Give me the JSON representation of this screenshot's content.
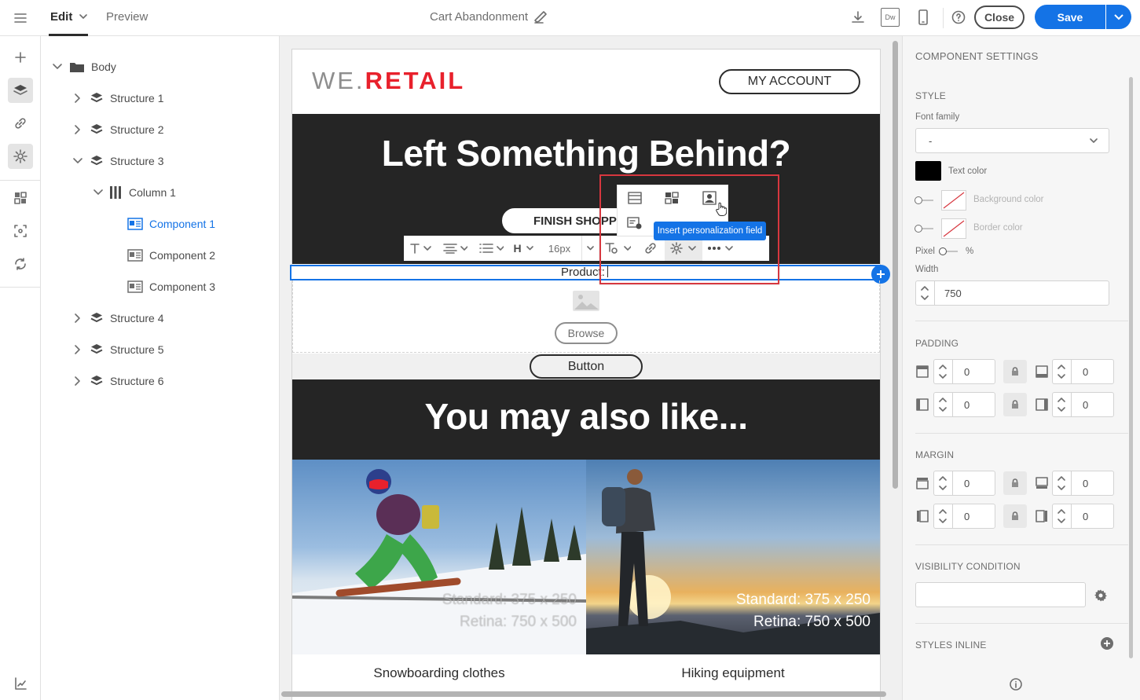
{
  "header": {
    "edit_label": "Edit",
    "preview_label": "Preview",
    "document_title": "Cart Abandonment",
    "close_label": "Close",
    "save_label": "Save",
    "dw_label": "Dw"
  },
  "tree": {
    "body_label": "Body",
    "items": [
      {
        "label": "Structure 1"
      },
      {
        "label": "Structure 2"
      },
      {
        "label": "Structure 3"
      },
      {
        "label": "Column 1"
      },
      {
        "label": "Component 1"
      },
      {
        "label": "Component 2"
      },
      {
        "label": "Component 3"
      },
      {
        "label": "Structure 4"
      },
      {
        "label": "Structure 5"
      },
      {
        "label": "Structure 6"
      }
    ]
  },
  "email": {
    "logo_part1": "WE.",
    "logo_part2": "RETAIL",
    "account_button": "MY ACCOUNT",
    "hero_title": "Left Something Behind?",
    "finish_button": "FINISH SHOPP",
    "product_text": "Product:",
    "browse_button": "Browse",
    "generic_button": "Button",
    "also_like_title": "You may also like...",
    "products": [
      {
        "caption": "Snowboarding clothes",
        "overlay1": "Standard: 375 x 250",
        "overlay2": "Retina: 750 x 500"
      },
      {
        "caption": "Hiking equipment",
        "overlay1": "Standard: 375 x 250",
        "overlay2": "Retina: 750 x 500"
      }
    ]
  },
  "toolbar": {
    "font_size": "16px",
    "heading_label": "H",
    "tooltip": "Insert personalization field"
  },
  "settings": {
    "title": "COMPONENT SETTINGS",
    "style_label": "STYLE",
    "font_family_label": "Font family",
    "font_family_value": "-",
    "text_color_label": "Text color",
    "text_color": "#000000",
    "background_color_label": "Background color",
    "border_color_label": "Border color",
    "pixel_label": "Pixel",
    "percent_label": "%",
    "width_label": "Width",
    "width_value": "750",
    "padding_label": "PADDING",
    "padding": {
      "top": "0",
      "bottom": "0",
      "left": "0",
      "right": "0"
    },
    "margin_label": "MARGIN",
    "margin": {
      "top": "0",
      "bottom": "0",
      "left": "0",
      "right": "0"
    },
    "visibility_label": "VISIBILITY CONDITION",
    "visibility_value": "",
    "styles_inline_label": "STYLES INLINE"
  },
  "colors": {
    "accent": "#1473e6",
    "brand_red": "#e8212c",
    "dark_band": "#252525",
    "highlight_red": "#d7373f",
    "tooltip_bg": "#1473e6"
  }
}
